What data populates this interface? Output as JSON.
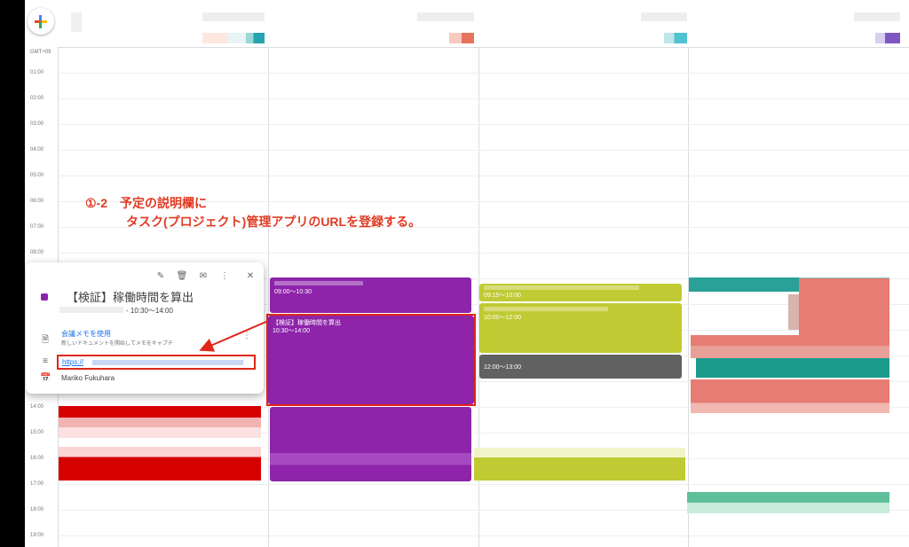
{
  "timezone_label": "GMT+09",
  "hours": [
    "01:00",
    "02:00",
    "03:00",
    "04:00",
    "05:00",
    "06:00",
    "07:00",
    "08:00",
    "14:00",
    "15:00",
    "16:00",
    "17:00",
    "18:00",
    "19:00"
  ],
  "annotation": {
    "number": "①-2",
    "line1": "予定の説明欄に",
    "line2": "タスク(プロジェクト)管理アプリのURLを登録する。"
  },
  "events": {
    "purple_top_time": "09:00～10:30",
    "selected_title": "【検証】稼働時間を算出",
    "selected_time": "10:30～14:00",
    "olive_1_time": "09:15～10:00",
    "olive_2_time": "10:00～12:00",
    "gray_time": "12:00～13:00"
  },
  "popup": {
    "title": "【検証】稼働時間を算出",
    "time": "- 10:30～14:00",
    "notes_link": "会議メモを使用",
    "notes_sub": "新しいドキュメントを開始してメモをキャプチ",
    "url_prefix": "https://",
    "organizer": "Mariko Fukuhara",
    "toolbar": {
      "edit_icon": "✎",
      "delete_icon": "🗑",
      "email_icon": "✉",
      "more_icon": "⋮",
      "close_icon": "✕"
    },
    "row_icons": {
      "document_icon": "🗎",
      "description_icon": "≡",
      "calendar_icon": "📅"
    }
  },
  "colors": {
    "purple": "#8e24aa",
    "olive": "#c0ca33",
    "graphite": "#616161",
    "tomato": "#d50000",
    "flamingo": "#e67c73",
    "peacock": "#039be5",
    "teal": "#009688",
    "sage": "#33b679",
    "annotation": "#e03b24"
  }
}
